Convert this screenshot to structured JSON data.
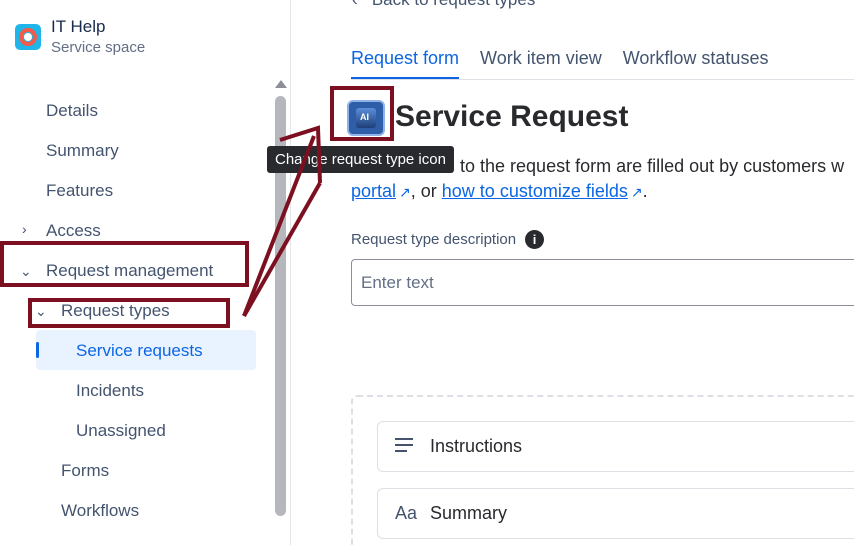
{
  "space": {
    "title": "IT Help",
    "subtitle": "Service space"
  },
  "sidebar": {
    "items": {
      "details": "Details",
      "summary": "Summary",
      "features": "Features",
      "access": "Access",
      "request_management": "Request management",
      "request_types": "Request types",
      "service_requests": "Service requests",
      "incidents": "Incidents",
      "unassigned": "Unassigned",
      "forms": "Forms",
      "workflows": "Workflows"
    }
  },
  "main": {
    "back_link": "Back to request types",
    "tabs": [
      "Request form",
      "Work item view",
      "Workflow statuses"
    ],
    "title": "Service Request",
    "tooltip": "Change request type icon",
    "description": {
      "line1": "to the request form are filled out by customers w",
      "portal_link": "portal",
      "middle": ", or ",
      "customize_link": "how to customize fields",
      "end": "."
    },
    "field_label": "Request type description",
    "input_placeholder": "Enter text",
    "cards": [
      "Instructions",
      "Summary"
    ],
    "summary_icon_text": "Aa"
  },
  "colors": {
    "accent": "#0c66e4",
    "annotation": "#7c1020"
  }
}
